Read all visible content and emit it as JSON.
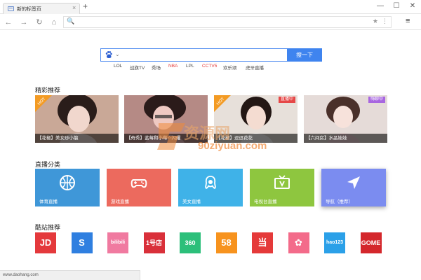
{
  "browser": {
    "tab_title": "新的标签页",
    "tab_close": "×",
    "new_tab": "+",
    "window_controls": {
      "minimize": "—",
      "maximize": "☐",
      "close": "✕"
    },
    "nav": {
      "back": "←",
      "forward": "→",
      "reload": "↻",
      "home": "⌂"
    },
    "url_value": "",
    "menu": "≡"
  },
  "search": {
    "query": "",
    "button_label": "搜一下",
    "quick_links": [
      {
        "label": "LOL",
        "highlight": false
      },
      {
        "label": "战旗TV",
        "highlight": false
      },
      {
        "label": "秀场",
        "highlight": false
      },
      {
        "label": "NBA",
        "highlight": true
      },
      {
        "label": "LPL",
        "highlight": false
      },
      {
        "label": "CCTV5",
        "highlight": true
      },
      {
        "label": "欢乐颂",
        "highlight": false
      },
      {
        "label": "虎牙直播",
        "highlight": false
      }
    ]
  },
  "featured": {
    "title": "精彩推荐",
    "cards": [
      {
        "caption": "【花椒】美女炒小龍",
        "badge": "HOT"
      },
      {
        "caption": "【奇秀】蓝莓和小莓☆闪耀",
        "badge": ""
      },
      {
        "caption": "【花椒】逗逗花花",
        "badge": "HOT",
        "status": "直播中"
      },
      {
        "caption": "【六间房】水晶娃娃",
        "badge": "",
        "status": "嗨聊中"
      }
    ]
  },
  "categories": {
    "title": "直播分类",
    "items": [
      {
        "label": "体育直播",
        "icon": "basketball-icon",
        "color": "#3f97d8"
      },
      {
        "label": "游戏直播",
        "icon": "gamepad-icon",
        "color": "#ec6a5e"
      },
      {
        "label": "美女直播",
        "icon": "woman-icon",
        "color": "#3fb2e8"
      },
      {
        "label": "电视台直播",
        "icon": "tv-icon",
        "color": "#8ec63f"
      },
      {
        "label": "导航（推荐）",
        "icon": "navigation-arrow-icon",
        "color": "#7b8cf0"
      }
    ]
  },
  "sites": {
    "title": "酷站推荐",
    "items": [
      {
        "name": "jd-logo",
        "text": "JD",
        "color": "#e4393c"
      },
      {
        "name": "sogou-logo",
        "text": "S",
        "color": "#2f7fe0"
      },
      {
        "name": "bilibili-logo",
        "text": "bilibili",
        "color": "#f07aa0"
      },
      {
        "name": "1hao-logo",
        "text": "1号店",
        "color": "#d9303a"
      },
      {
        "name": "360-logo",
        "text": "360",
        "color": "#2cbf7a"
      },
      {
        "name": "58-logo",
        "text": "58",
        "color": "#f7931e"
      },
      {
        "name": "meituan-logo",
        "text": "当",
        "color": "#e53a3a"
      },
      {
        "name": "flower-logo",
        "text": "✿",
        "color": "#f36b8a"
      },
      {
        "name": "hao123-logo",
        "text": "hao123",
        "color": "#2ba0e8"
      },
      {
        "name": "gome-logo",
        "text": "GOME",
        "color": "#d4272c"
      }
    ]
  },
  "watermark": {
    "text": "资源网",
    "url": "90ziyuan.com"
  },
  "statusbar": {
    "text": "www.daohang.com"
  }
}
